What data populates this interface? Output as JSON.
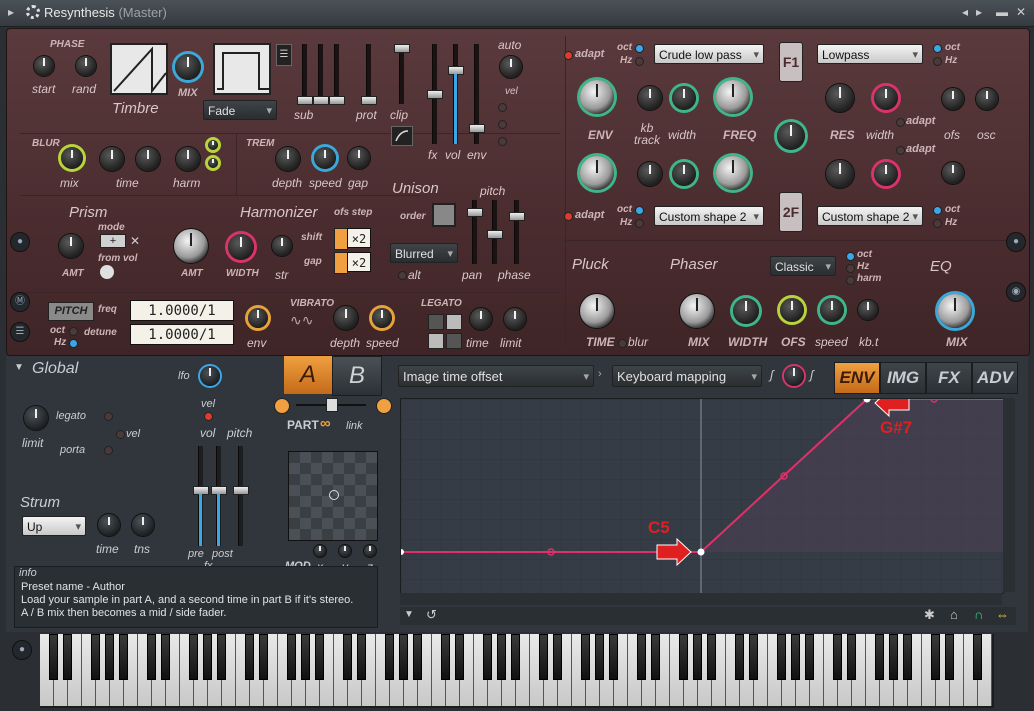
{
  "window": {
    "title": "Resynthesis",
    "subtitle": "(Master)"
  },
  "timbre": {
    "header": "PHASE",
    "start": "start",
    "rand": "rand",
    "title": "Timbre",
    "mix": "MIX",
    "mode": "Fade"
  },
  "faders_top": {
    "sub": "sub",
    "prot": "prot",
    "clip": "clip",
    "fx": "fx",
    "vol": "vol",
    "env": "env",
    "auto": "auto",
    "vel": "vel"
  },
  "blur": {
    "header": "BLUR",
    "mix": "mix",
    "time": "time",
    "harm": "harm"
  },
  "trem": {
    "header": "TREM",
    "depth": "depth",
    "speed": "speed",
    "gap": "gap"
  },
  "unison": {
    "title": "Unison",
    "order": "order",
    "pitch": "pitch",
    "mode": "Blurred",
    "alt": "alt",
    "pan": "pan",
    "phase": "phase"
  },
  "prism": {
    "title": "Prism",
    "mode": "mode",
    "from_vol": "from vol",
    "amt": "AMT"
  },
  "harmonizer": {
    "title": "Harmonizer",
    "amt": "AMT",
    "width": "WIDTH",
    "str": "str",
    "ofs_step": "ofs step",
    "shift": "shift",
    "gap": "gap",
    "shift_val": "×2",
    "gap_val": "×2"
  },
  "pitch": {
    "tag": "PITCH",
    "freq": "freq",
    "detune": "detune",
    "freq_val": "1.0000/1",
    "detune_val": "1.0000/1",
    "oct": "oct",
    "hz": "Hz",
    "env": "env"
  },
  "vibrato": {
    "header": "VIBRATO",
    "depth": "depth",
    "speed": "speed"
  },
  "legato": {
    "header": "LEGATO",
    "time": "time",
    "limit": "limit"
  },
  "filter1": {
    "adapt": "adapt",
    "oct": "oct",
    "hz": "Hz",
    "type": "Crude low pass",
    "badge": "F1",
    "env": "ENV",
    "kb_track": "kb\ntrack",
    "width": "width",
    "freq": "FREQ",
    "mode": "Lowpass",
    "res": "RES",
    "width2": "width",
    "adapt2": "adapt",
    "ofs": "ofs",
    "osc": "osc"
  },
  "filter2": {
    "adapt": "adapt",
    "oct": "oct",
    "hz": "Hz",
    "type": "Custom shape 2",
    "badge": "2F",
    "mode": "Custom shape 2",
    "adapt2": "adapt"
  },
  "pluck": {
    "title": "Pluck",
    "time": "TIME",
    "blur": "blur"
  },
  "phaser": {
    "title": "Phaser",
    "mode": "Classic",
    "oct": "oct",
    "hz": "Hz",
    "harm": "harm",
    "mix": "MIX",
    "width": "WIDTH",
    "ofs": "OFS",
    "speed": "speed",
    "kbt": "kb.t"
  },
  "eq": {
    "title": "EQ",
    "mix": "MIX"
  },
  "global": {
    "title": "Global",
    "lfo": "lfo",
    "legato": "legato",
    "vel": "vel",
    "porta": "porta",
    "limit": "limit",
    "strum": "Strum",
    "strum_mode": "Up",
    "time": "time",
    "tns": "tns",
    "vel2": "vel",
    "vol": "vol",
    "pitch": "pitch",
    "pre": "pre",
    "post": "post",
    "fx": "fx"
  },
  "part": {
    "a": "A",
    "b": "B",
    "part": "PART",
    "link": "link",
    "mod": "MOD",
    "x": "x",
    "y": "y",
    "z": "z"
  },
  "envelope": {
    "source": "Image time offset",
    "target": "Keyboard mapping",
    "tabs": [
      "ENV",
      "IMG",
      "FX",
      "ADV"
    ],
    "active_tab": "ENV",
    "point_labels": [
      "C5",
      "G#7"
    ]
  },
  "info": {
    "header": "info",
    "lines": [
      "Preset name - Author",
      "Load your sample in part A, and a second time in part B if it's stereo.",
      "A / B mix then becomes a mid / side fader."
    ]
  },
  "colors": {
    "accent": "#f0a040",
    "envelope": "#e0306a",
    "panel": "#4a2c2f"
  }
}
